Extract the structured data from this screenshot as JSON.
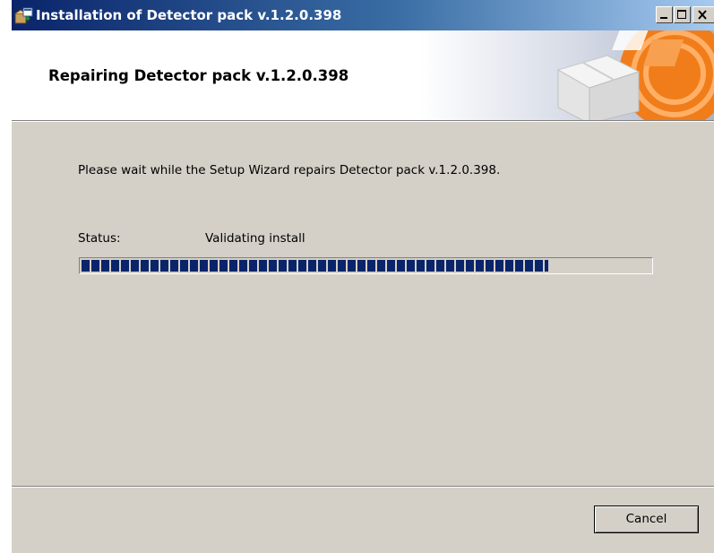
{
  "window": {
    "title": "Installation of Detector pack v.1.2.0.398"
  },
  "banner": {
    "title": "Repairing Detector pack v.1.2.0.398"
  },
  "main": {
    "description": "Please wait while the Setup Wizard repairs Detector pack v.1.2.0.398.",
    "status_label": "Status:",
    "status_value": "Validating install",
    "progress_fraction": 0.82
  },
  "footer": {
    "cancel_label": "Cancel"
  },
  "colors": {
    "titlebar_start": "#0a246a",
    "titlebar_end": "#a6caf0",
    "dialog_background": "#d4d0c8",
    "progress_fill": "#0a246a",
    "brand_orange": "#f07d1a"
  },
  "icons": {
    "app": "installer-package-icon",
    "minimize": "minimize-icon",
    "maximize": "maximize-icon",
    "close": "close-icon",
    "banner": "package-box-icon"
  }
}
